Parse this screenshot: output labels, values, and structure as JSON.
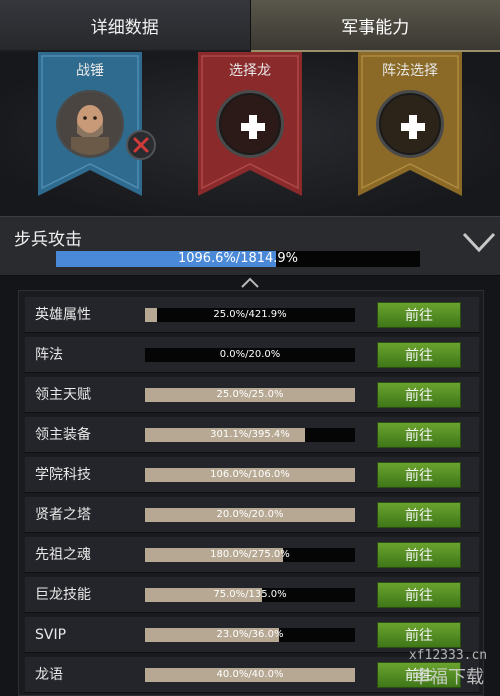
{
  "tabs": [
    {
      "label": "详细数据",
      "active": false
    },
    {
      "label": "军事能力",
      "active": true
    }
  ],
  "banners": [
    {
      "label": "战锤",
      "color": "#2f6b8e",
      "type": "hero"
    },
    {
      "label": "选择龙",
      "color": "#8a2a2a",
      "type": "add"
    },
    {
      "label": "阵法选择",
      "color": "#8a6a26",
      "type": "add"
    }
  ],
  "attack": {
    "title": "步兵攻击",
    "text": "1096.6%/1814.9%",
    "progress": 0.604,
    "fill_color": "#4a88d8"
  },
  "rows": [
    {
      "label": "英雄属性",
      "text": "25.0%/421.9%",
      "progress": 0.059,
      "button": "前往"
    },
    {
      "label": "阵法",
      "text": "0.0%/20.0%",
      "progress": 0.0,
      "button": "前往"
    },
    {
      "label": "领主天赋",
      "text": "25.0%/25.0%",
      "progress": 1.0,
      "button": "前往"
    },
    {
      "label": "领主装备",
      "text": "301.1%/395.4%",
      "progress": 0.762,
      "button": "前往"
    },
    {
      "label": "学院科技",
      "text": "106.0%/106.0%",
      "progress": 1.0,
      "button": "前往"
    },
    {
      "label": "贤者之塔",
      "text": "20.0%/20.0%",
      "progress": 1.0,
      "button": "前往"
    },
    {
      "label": "先祖之魂",
      "text": "180.0%/275.0%",
      "progress": 0.655,
      "button": "前往"
    },
    {
      "label": "巨龙技能",
      "text": "75.0%/135.0%",
      "progress": 0.556,
      "button": "前往"
    },
    {
      "label": "SVIP",
      "text": "23.0%/36.0%",
      "progress": 0.639,
      "button": "前往"
    },
    {
      "label": "龙语",
      "text": "40.0%/40.0%",
      "progress": 1.0,
      "button": "前往"
    }
  ],
  "watermark": {
    "line1": "xf12333.cn",
    "line2": "幸福下载"
  }
}
